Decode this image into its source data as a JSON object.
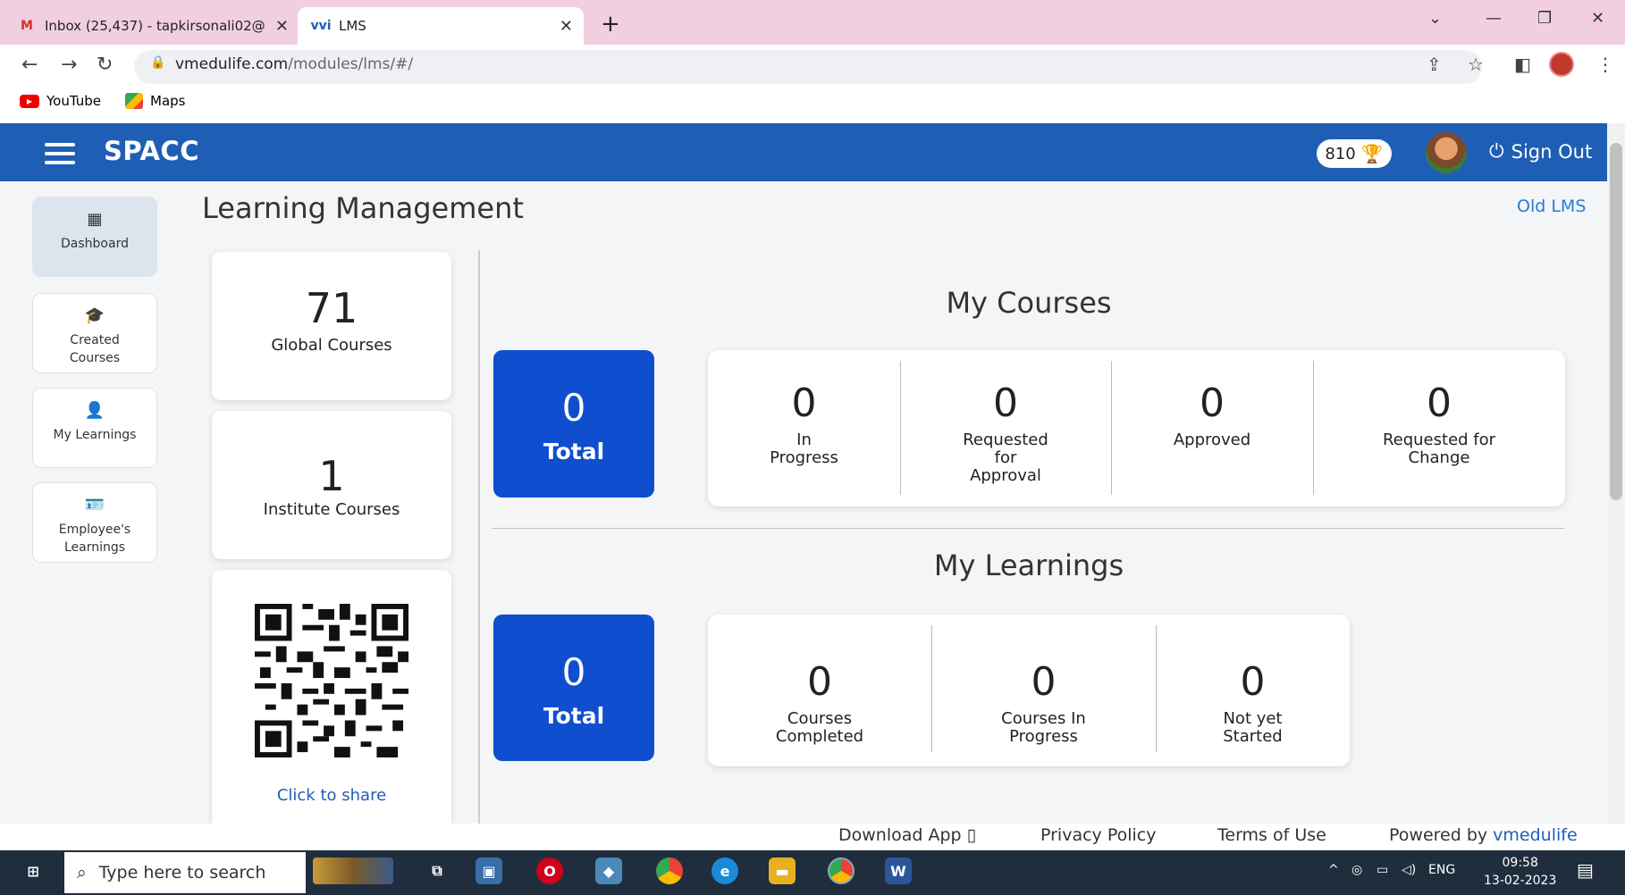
{
  "browser": {
    "tabs": [
      {
        "title": "Inbox (25,437) - tapkirsonali02@",
        "favicon": "gmail-icon"
      },
      {
        "title": "LMS",
        "favicon": "vmedulife-icon"
      }
    ],
    "url_host": "vmedulife.com",
    "url_path": "/modules/lms/#/",
    "bookmarks": [
      "YouTube",
      "Maps"
    ]
  },
  "app": {
    "brand": "SPACC",
    "points": "810",
    "signout_label": "Sign Out",
    "page_title": "Learning Management",
    "old_lms_label": "Old LMS"
  },
  "sidebar": {
    "items": [
      {
        "label_line1": "Dashboard",
        "label_line2": "",
        "icon": "grid-icon",
        "active": true
      },
      {
        "label_line1": "Created",
        "label_line2": "Courses",
        "icon": "graduation-cap-icon",
        "active": false
      },
      {
        "label_line1": "My Learnings",
        "label_line2": "",
        "icon": "reader-icon",
        "active": false
      },
      {
        "label_line1": "Employee's",
        "label_line2": "Learnings",
        "icon": "id-badge-icon",
        "active": false
      }
    ]
  },
  "stats": {
    "global": {
      "value": "71",
      "label": "Global Courses"
    },
    "institute": {
      "value": "1",
      "label": "Institute Courses"
    },
    "share_label": "Click to share"
  },
  "my_courses": {
    "title": "My Courses",
    "total_value": "0",
    "total_label": "Total",
    "metrics": [
      {
        "value": "0",
        "label_lines": [
          "In",
          "Progress"
        ]
      },
      {
        "value": "0",
        "label_lines": [
          "Requested",
          "for",
          "Approval"
        ]
      },
      {
        "value": "0",
        "label_lines": [
          "Approved"
        ]
      },
      {
        "value": "0",
        "label_lines": [
          "Requested for",
          "Change"
        ]
      }
    ]
  },
  "my_learnings": {
    "title": "My Learnings",
    "total_value": "0",
    "total_label": "Total",
    "metrics": [
      {
        "value": "0",
        "label_lines": [
          "Courses",
          "Completed"
        ]
      },
      {
        "value": "0",
        "label_lines": [
          "Courses In",
          "Progress"
        ]
      },
      {
        "value": "0",
        "label_lines": [
          "Not yet",
          "Started"
        ]
      }
    ]
  },
  "footer": {
    "download": "Download App",
    "privacy": "Privacy Policy",
    "terms": "Terms of Use",
    "powered": "Powered by",
    "powered_brand": "vmedulife"
  },
  "taskbar": {
    "search_placeholder": "Type here to search",
    "lang": "ENG",
    "time": "09:58",
    "date": "13-02-2023"
  },
  "colors": {
    "appbar": "#1e5fb5",
    "total_box": "#0f4fcf",
    "link": "#2a7bd8"
  }
}
